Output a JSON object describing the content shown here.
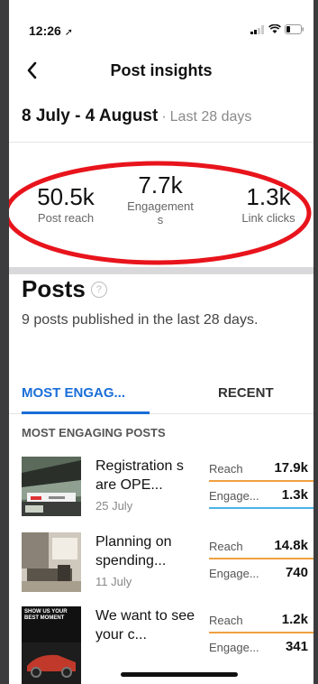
{
  "status": {
    "time": "12:26"
  },
  "header": {
    "title": "Post insights"
  },
  "date_range": {
    "range": "8 July - 4 August",
    "separator": "·",
    "period": "Last 28 days"
  },
  "metrics": [
    {
      "value": "50.5k",
      "label": "Post reach"
    },
    {
      "value": "7.7k",
      "label_line1": "Engagement",
      "label_line2": "s"
    },
    {
      "value": "1.3k",
      "label": "Link clicks"
    }
  ],
  "posts_section": {
    "title": "Posts",
    "help": "?",
    "subtitle": "9 posts published in the last 28 days."
  },
  "tabs": [
    {
      "label": "MOST ENGAG...",
      "active": true
    },
    {
      "label": "RECENT",
      "active": false
    }
  ],
  "section_label": "MOST ENGAGING POSTS",
  "posts": [
    {
      "title": "Registration s are OPE...",
      "date": "25 July",
      "reach_label": "Reach",
      "reach": "17.9k",
      "engage_label": "Engage...",
      "engagement": "1.3k"
    },
    {
      "title": "Planning on spending...",
      "date": "11 July",
      "reach_label": "Reach",
      "reach": "14.8k",
      "engage_label": "Engage...",
      "engagement": "740"
    },
    {
      "title": "We want to see your c...",
      "date": "",
      "reach_label": "Reach",
      "reach": "1.2k",
      "engage_label": "Engage...",
      "engagement": "341",
      "thumb_text": "SHOW US YOUR BEST MOMENT"
    }
  ],
  "colors": {
    "accent": "#1a6ed8",
    "annotation": "#e8141c",
    "reach_bar": "#f0a040",
    "engage_bar": "#4bb3e8"
  }
}
